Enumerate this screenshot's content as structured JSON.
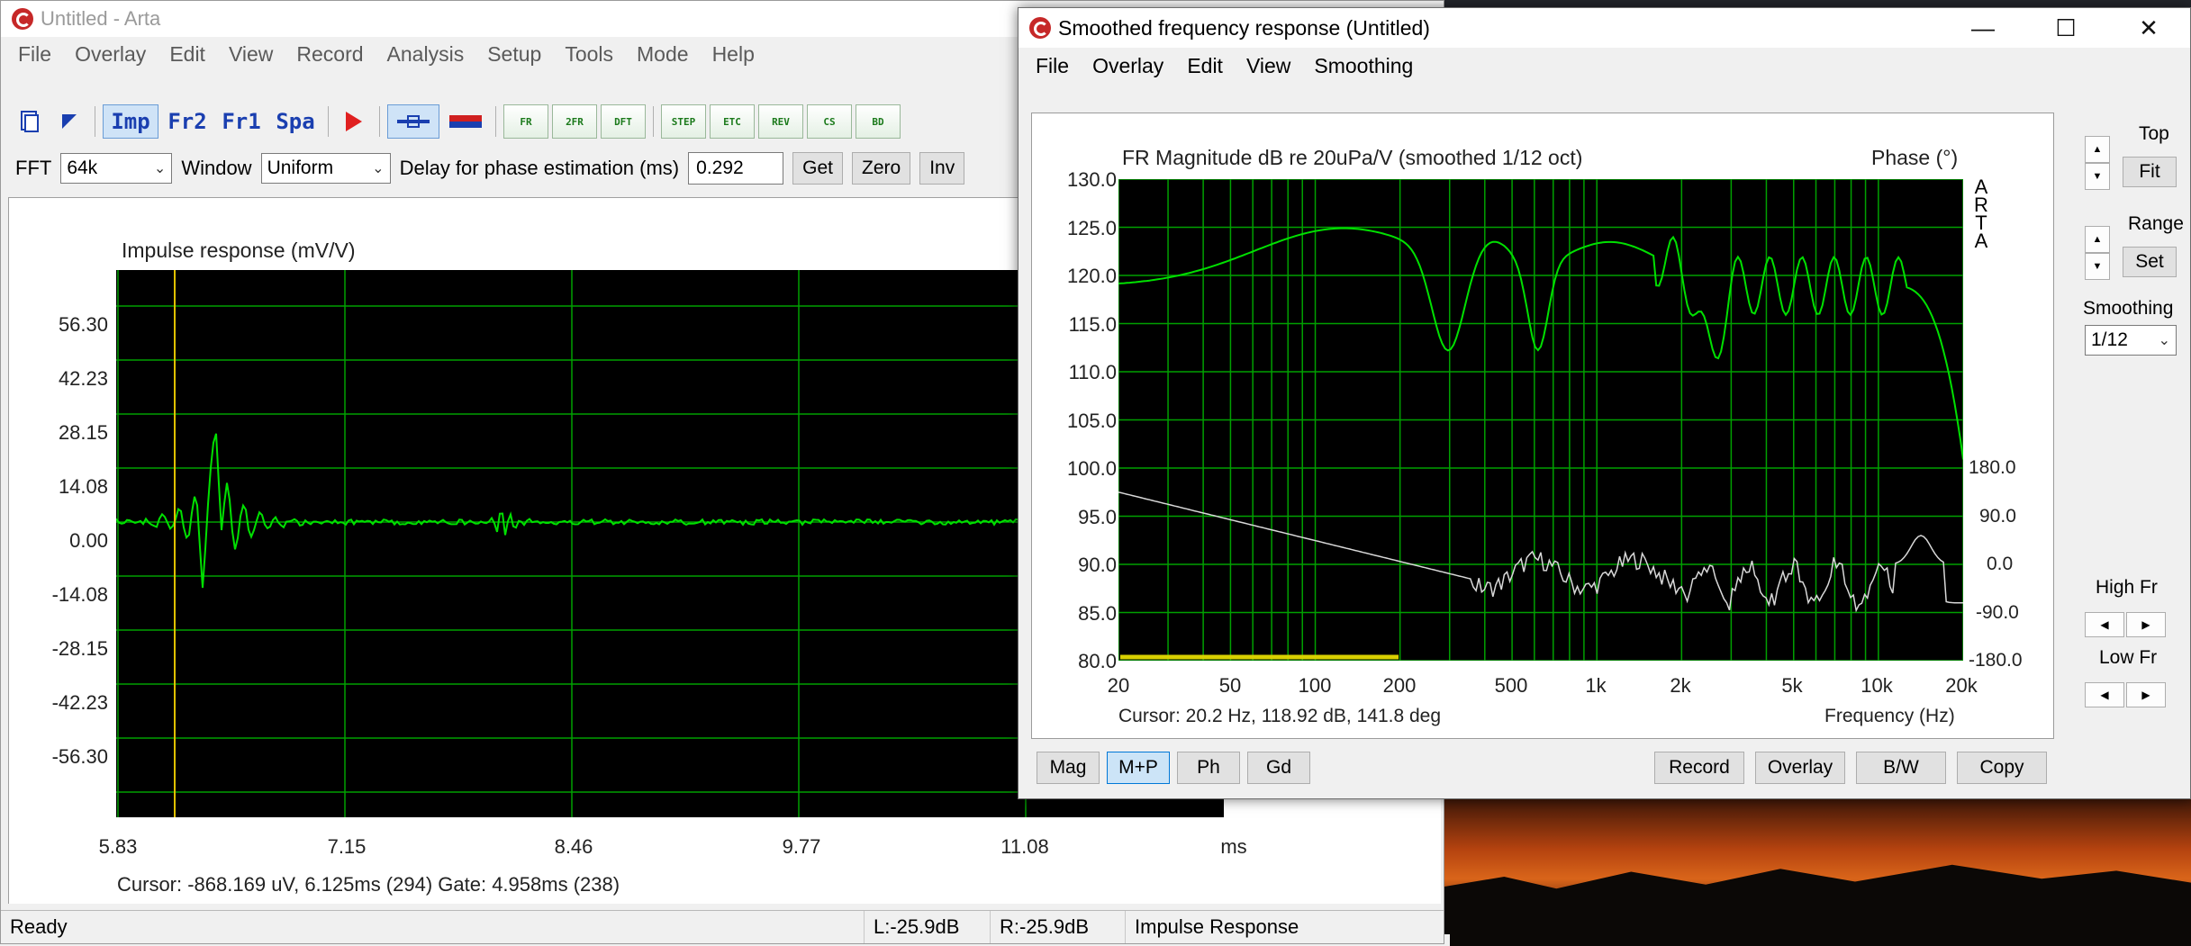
{
  "main_window": {
    "title": "Untitled - Arta",
    "menu": [
      "File",
      "Overlay",
      "Edit",
      "View",
      "Record",
      "Analysis",
      "Setup",
      "Tools",
      "Mode",
      "Help"
    ],
    "toolbar": {
      "mode_buttons": [
        "Imp",
        "Fr2",
        "Fr1",
        "Spa"
      ],
      "small_buttons": [
        "FR",
        "2FR",
        "DFT",
        "STEP",
        "ETC",
        "REV",
        "CS",
        "BD"
      ]
    },
    "controls": {
      "fft_label": "FFT",
      "fft_value": "64k",
      "window_label": "Window",
      "window_value": "Uniform",
      "delay_label": "Delay for phase estimation (ms)",
      "delay_value": "0.292",
      "get_label": "Get",
      "zero_label": "Zero",
      "inv_label": "Inv"
    },
    "impulse_plot": {
      "title": "Impulse response (mV/V)",
      "y_ticks": [
        "56.30",
        "42.23",
        "28.15",
        "14.08",
        "0.00",
        "-14.08",
        "-28.15",
        "-42.23",
        "-56.30"
      ],
      "x_ticks": [
        "5.83",
        "7.15",
        "8.46",
        "9.77",
        "11.08"
      ],
      "x_unit": "ms",
      "cursor_text": "Cursor: -868.169 uV, 6.125ms (294)  Gate: 4.958ms (238)",
      "trace_color": "#00e000",
      "cursor_color": "#e0c000"
    },
    "status": {
      "ready": "Ready",
      "left_level": "L:-25.9dB",
      "right_level": "R:-25.9dB",
      "mode": "Impulse Response"
    }
  },
  "fr_window": {
    "title": "Smoothed frequency response (Untitled)",
    "menu": [
      "File",
      "Overlay",
      "Edit",
      "View",
      "Smoothing"
    ],
    "window_controls": [
      "—",
      "☐",
      "✕"
    ],
    "plot": {
      "title": "FR Magnitude dB re 20uPa/V (smoothed 1/12 oct)",
      "phase_title": "Phase (°)",
      "brand": [
        "A",
        "R",
        "T",
        "A"
      ],
      "y_ticks": [
        "130.0",
        "125.0",
        "120.0",
        "115.0",
        "110.0",
        "105.0",
        "100.0",
        "95.0",
        "90.0",
        "85.0",
        "80.0"
      ],
      "phase_ticks": [
        "180.0",
        "90.0",
        "0.0",
        "-90.0",
        "-180.0"
      ],
      "x_ticks": [
        "20",
        "50",
        "100",
        "200",
        "500",
        "1k",
        "2k",
        "5k",
        "10k",
        "20k"
      ],
      "x_axis_label": "Frequency (Hz)",
      "cursor_text": "Cursor: 20.2 Hz, 118.92 dB, 141.8 deg",
      "magnitude_color": "#00e000",
      "phase_color": "#d8d8d8",
      "gate_color": "#d8d000"
    },
    "side_panel": {
      "top_label": "Top",
      "fit_label": "Fit",
      "range_label": "Range",
      "set_label": "Set",
      "smoothing_label": "Smoothing",
      "smoothing_value": "1/12",
      "high_fr_label": "High Fr",
      "low_fr_label": "Low Fr"
    },
    "bottom_buttons": {
      "mag": "Mag",
      "mp": "M+P",
      "ph": "Ph",
      "gd": "Gd",
      "record": "Record",
      "overlay": "Overlay",
      "bw": "B/W",
      "copy": "Copy"
    }
  }
}
